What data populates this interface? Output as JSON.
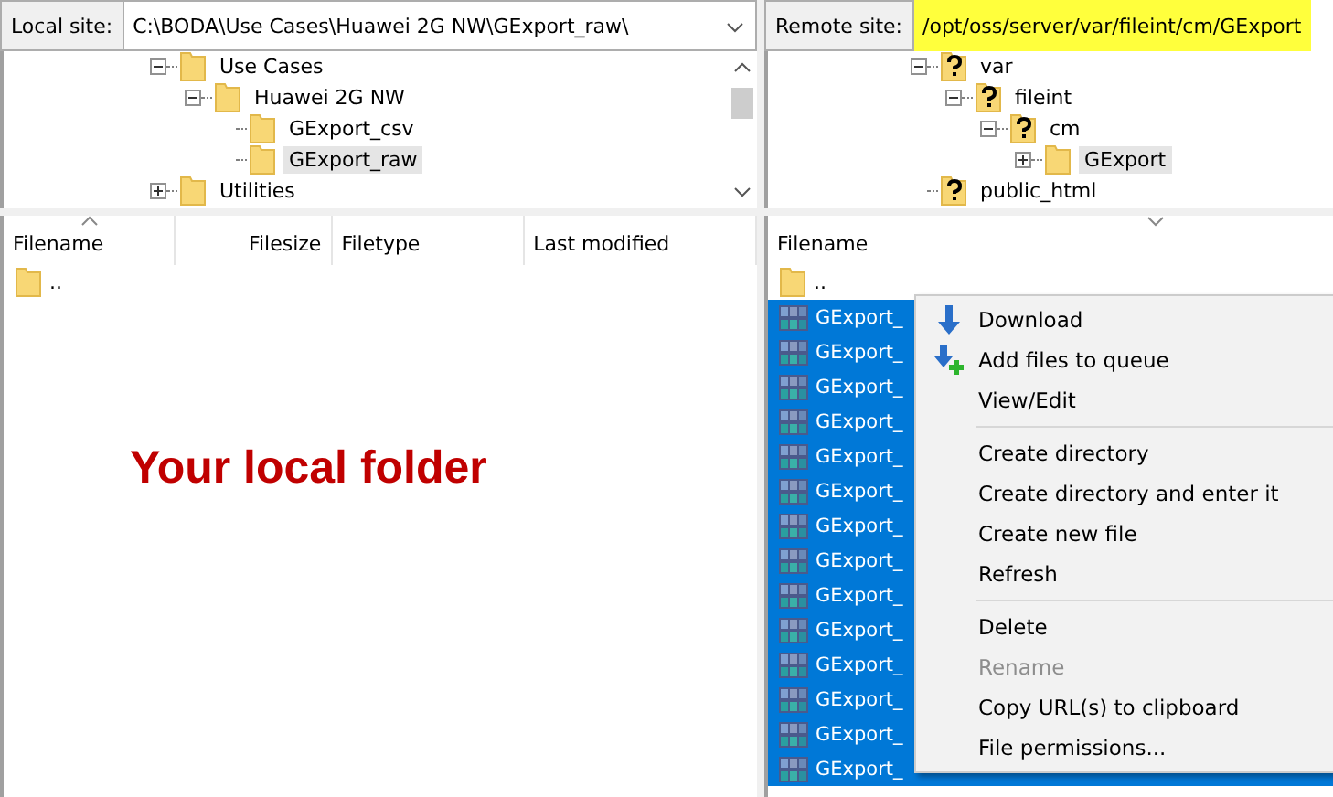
{
  "local": {
    "site_label": "Local site:",
    "path": "C:\\BODA\\Use Cases\\Huawei 2G NW\\GExport_raw\\",
    "highlighted": false,
    "tree": [
      {
        "label": "Use Cases",
        "kind": "folder",
        "expanded": true,
        "selected": false,
        "children": [
          {
            "label": "Huawei 2G NW",
            "kind": "folder",
            "expanded": true,
            "selected": false,
            "children": [
              {
                "label": "GExport_csv",
                "kind": "folder",
                "selected": false
              },
              {
                "label": "GExport_raw",
                "kind": "folder",
                "selected": true
              }
            ]
          }
        ]
      },
      {
        "label": "Utilities",
        "kind": "folder",
        "expanded": false,
        "selected": false
      }
    ],
    "columns": [
      "Filename",
      "Filesize",
      "Filetype",
      "Last modified"
    ],
    "rows": [
      {
        "name": "..",
        "kind": "folder",
        "selected": false
      }
    ],
    "annotation": "Your local folder"
  },
  "remote": {
    "site_label": "Remote site:",
    "path": "/opt/oss/server/var/fileint/cm/GExport",
    "highlighted": true,
    "tree": [
      {
        "label": "var",
        "kind": "unknown",
        "expanded": true,
        "selected": false,
        "children": [
          {
            "label": "fileint",
            "kind": "unknown",
            "expanded": true,
            "selected": false,
            "children": [
              {
                "label": "cm",
                "kind": "unknown",
                "expanded": true,
                "selected": false,
                "children": [
                  {
                    "label": "GExport",
                    "kind": "folder",
                    "expanded": false,
                    "selected": true
                  }
                ]
              }
            ]
          }
        ]
      },
      {
        "label": "public_html",
        "kind": "unknown",
        "selected": false
      }
    ],
    "columns": [
      "Filename"
    ],
    "rows": [
      {
        "name": "..",
        "kind": "folder",
        "selected": false
      },
      {
        "name": "GExport_",
        "kind": "file",
        "selected": true
      },
      {
        "name": "GExport_",
        "kind": "file",
        "selected": true
      },
      {
        "name": "GExport_",
        "kind": "file",
        "selected": true
      },
      {
        "name": "GExport_",
        "kind": "file",
        "selected": true
      },
      {
        "name": "GExport_",
        "kind": "file",
        "selected": true
      },
      {
        "name": "GExport_",
        "kind": "file",
        "selected": true
      },
      {
        "name": "GExport_",
        "kind": "file",
        "selected": true
      },
      {
        "name": "GExport_",
        "kind": "file",
        "selected": true
      },
      {
        "name": "GExport_",
        "kind": "file",
        "selected": true
      },
      {
        "name": "GExport_",
        "kind": "file",
        "selected": true
      },
      {
        "name": "GExport_",
        "kind": "file",
        "selected": true
      },
      {
        "name": "GExport_",
        "kind": "file",
        "selected": true
      },
      {
        "name": "GExport_",
        "kind": "file",
        "selected": true
      },
      {
        "name": "GExport_",
        "kind": "file",
        "selected": true
      }
    ]
  },
  "context_menu": {
    "groups": [
      [
        {
          "label": "Download",
          "kind": "download",
          "disabled": false
        },
        {
          "label": "Add files to queue",
          "kind": "add-queue",
          "disabled": false
        },
        {
          "label": "View/Edit",
          "kind": "plain",
          "disabled": false
        }
      ],
      [
        {
          "label": "Create directory",
          "kind": "plain",
          "disabled": false
        },
        {
          "label": "Create directory and enter it",
          "kind": "plain",
          "disabled": false
        },
        {
          "label": "Create new file",
          "kind": "plain",
          "disabled": false
        },
        {
          "label": "Refresh",
          "kind": "plain",
          "disabled": false
        }
      ],
      [
        {
          "label": "Delete",
          "kind": "plain",
          "disabled": false
        },
        {
          "label": "Rename",
          "kind": "plain",
          "disabled": true
        },
        {
          "label": "Copy URL(s) to clipboard",
          "kind": "plain",
          "disabled": false
        },
        {
          "label": "File permissions...",
          "kind": "plain",
          "disabled": false
        }
      ]
    ]
  }
}
